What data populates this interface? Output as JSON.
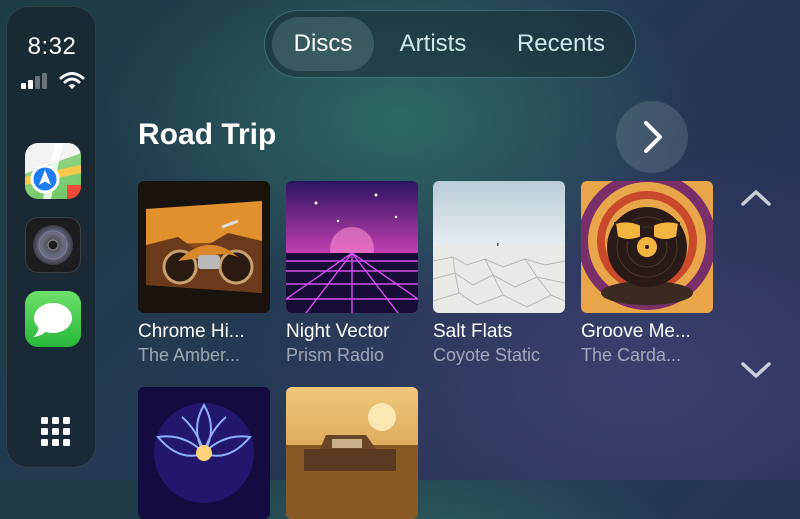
{
  "status": {
    "time": "8:32"
  },
  "sidebar": {
    "apps": [
      {
        "name": "Maps",
        "icon": "maps-icon"
      },
      {
        "name": "Music",
        "icon": "music-disc-icon"
      },
      {
        "name": "Messages",
        "icon": "messages-icon"
      }
    ],
    "grid_icon": "app-grid-icon"
  },
  "tabs": [
    {
      "label": "Discs",
      "active": true
    },
    {
      "label": "Artists",
      "active": false
    },
    {
      "label": "Recents",
      "active": false
    }
  ],
  "section": {
    "title": "Road Trip"
  },
  "albums": [
    {
      "title": "Chrome Hi...",
      "artist": "The Amber..."
    },
    {
      "title": "Night Vector",
      "artist": "Prism Radio"
    },
    {
      "title": "Salt Flats",
      "artist": "Coyote Static"
    },
    {
      "title": "Groove Me...",
      "artist": "The Carda..."
    },
    {
      "title": "",
      "artist": ""
    },
    {
      "title": "",
      "artist": ""
    }
  ],
  "colors": {
    "accent_tab_border": "#78c8d2",
    "messages_green": "#34c759"
  }
}
